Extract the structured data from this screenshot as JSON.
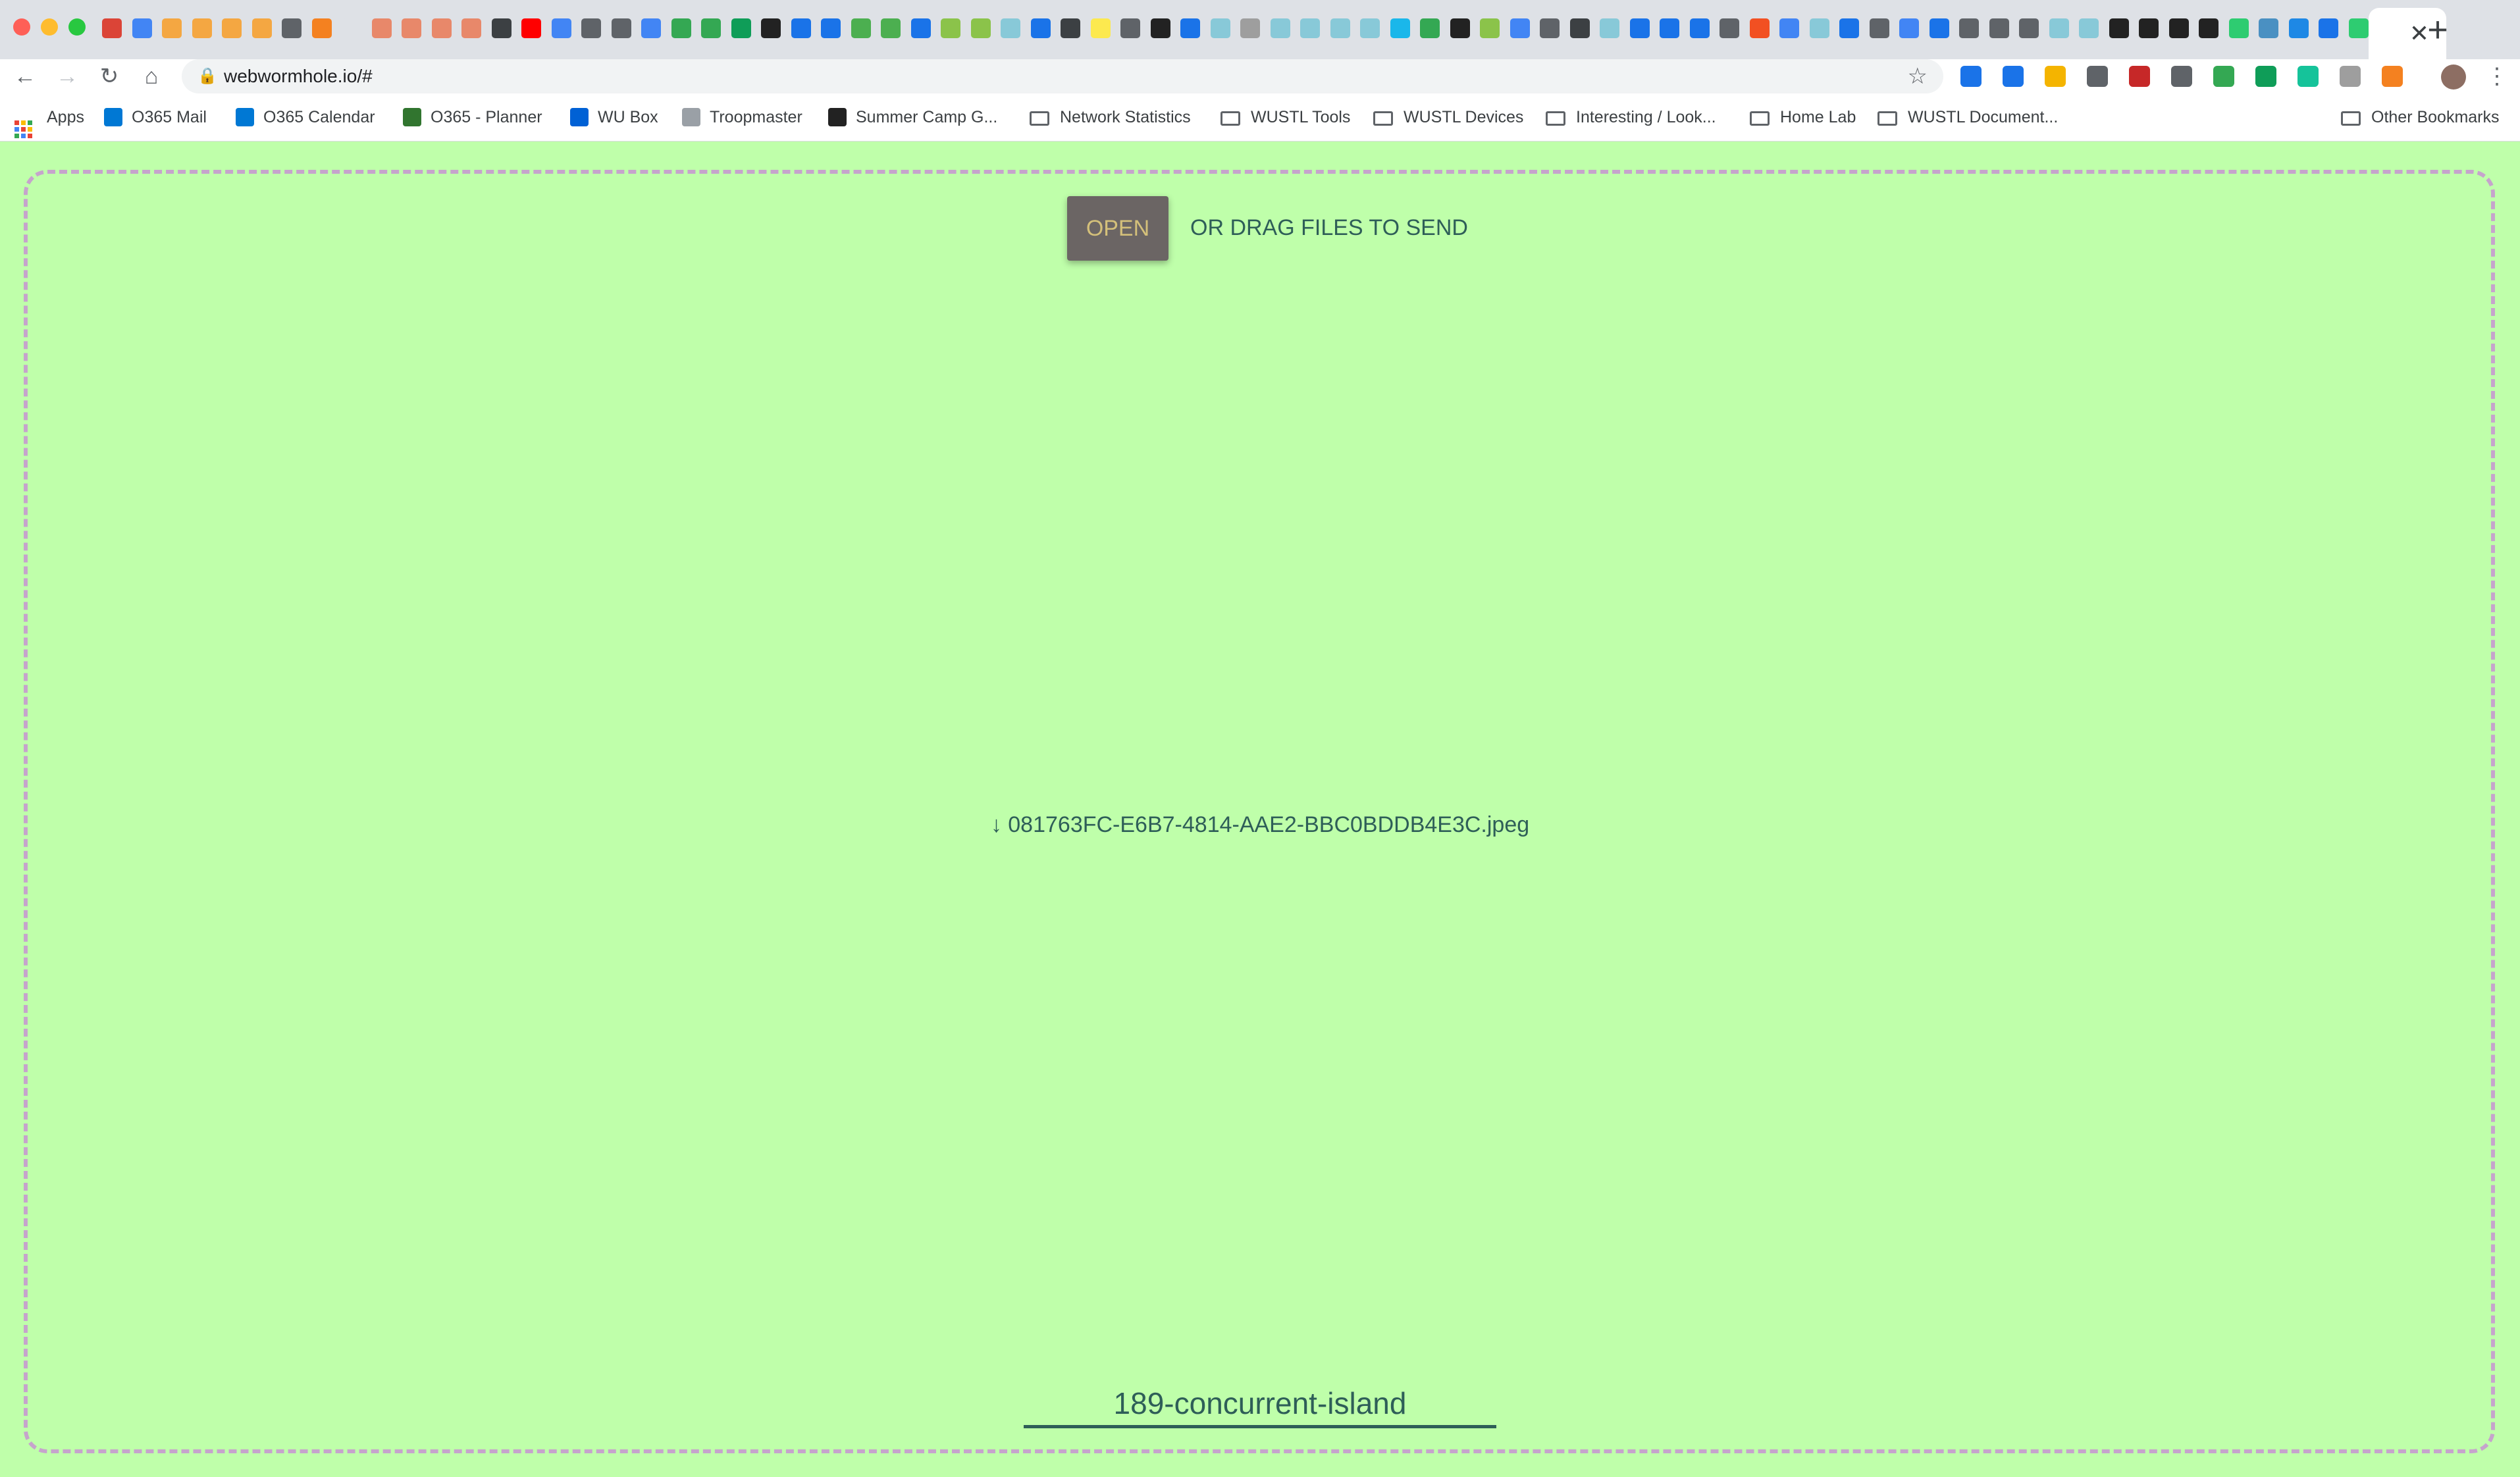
{
  "browser": {
    "url": "webwormhole.io/#",
    "tab_close": "✕",
    "new_tab": "+",
    "tab_favicon_colors": [
      "#db4437",
      "#4285f4",
      "#f4a742",
      "#f4a742",
      "#f4a742",
      "#f4a742",
      "#5f6368",
      "#f48120",
      "#dee1e6",
      "#e8886a",
      "#e8886a",
      "#e8886a",
      "#e8886a",
      "#3c4043",
      "#ff0000",
      "#4285f4",
      "#5f6368",
      "#5f6368",
      "#4285f4",
      "#34a853",
      "#34a853",
      "#0f9d58",
      "#222222",
      "#1a73e8",
      "#1a73e8",
      "#4caf50",
      "#4caf50",
      "#1a73e8",
      "#8bc34a",
      "#8bc34a",
      "#88c9d8",
      "#1a73e8",
      "#3c4043",
      "#fce94f",
      "#5f6368",
      "#222222",
      "#1a73e8",
      "#88c9d8",
      "#9e9e9e",
      "#88c9d8",
      "#88c9d8",
      "#88c9d8",
      "#88c9d8",
      "#1ab7ea",
      "#34a853",
      "#222222",
      "#8bc34a",
      "#4285f4",
      "#5f6368",
      "#3c4043",
      "#88c9d8",
      "#1a73e8",
      "#1a73e8",
      "#1a73e8",
      "#5f6368",
      "#f25022",
      "#4285f4",
      "#88c9d8",
      "#1a73e8",
      "#5f6368",
      "#4285f4",
      "#1a73e8",
      "#5f6368",
      "#5f6368",
      "#5f6368",
      "#88c9d8",
      "#88c9d8",
      "#222222",
      "#222222",
      "#222222",
      "#222222",
      "#2ecc71",
      "#4a90c2",
      "#1e88e5",
      "#1a73e8",
      "#2ecc71"
    ],
    "extension_colors": [
      "#1a73e8",
      "#1a73e8",
      "#f4b400",
      "#5f6368",
      "#c62828",
      "#5f6368",
      "#34a853",
      "#0f9d58",
      "#15c39a",
      "#9e9e9e",
      "#f48120"
    ]
  },
  "bookmarks": [
    {
      "label": "Apps",
      "icon": "apps-grid-icon",
      "color": "#ea4335"
    },
    {
      "label": "O365 Mail",
      "icon": "outlook-icon",
      "color": "#0078d4"
    },
    {
      "label": "O365 Calendar",
      "icon": "calendar-icon",
      "color": "#0078d4"
    },
    {
      "label": "O365 - Planner",
      "icon": "planner-icon",
      "color": "#31752f"
    },
    {
      "label": "WU Box",
      "icon": "box-icon",
      "color": "#0061d5"
    },
    {
      "label": "Troopmaster",
      "icon": "document-icon",
      "color": "#9aa0a6"
    },
    {
      "label": "Summer Camp G...",
      "icon": "moose-icon",
      "color": "#222222"
    },
    {
      "label": "Network Statistics",
      "icon": "folder-icon"
    },
    {
      "label": "WUSTL Tools",
      "icon": "folder-icon"
    },
    {
      "label": "WUSTL Devices",
      "icon": "folder-icon"
    },
    {
      "label": "Interesting / Look...",
      "icon": "folder-icon"
    },
    {
      "label": "Home Lab",
      "icon": "folder-icon"
    },
    {
      "label": "WUSTL Document...",
      "icon": "folder-icon"
    },
    {
      "label": "Other Bookmarks",
      "icon": "folder-icon"
    }
  ],
  "page": {
    "open_label": "OPEN",
    "drag_text": "OR DRAG FILES TO SEND",
    "file_link": "↓ 081763FC-E6B7-4814-AAE2-BBC0BDDB4E3C.jpeg",
    "code_value": "189-concurrent-island",
    "background_color": "#bfffaa",
    "accent_color": "#2e5e58"
  }
}
